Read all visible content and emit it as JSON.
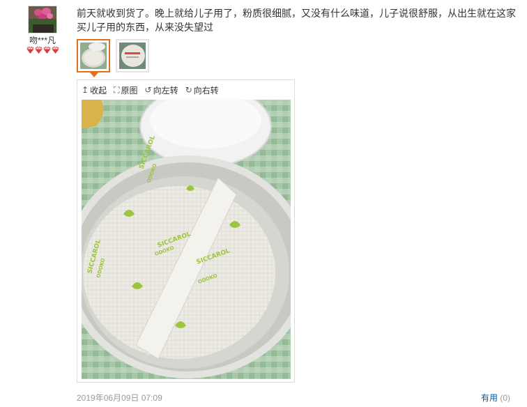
{
  "user": {
    "name": "吻***凡",
    "level_icon": "diamond-icon",
    "level_count": 4,
    "level_color": "#e4393c"
  },
  "review": {
    "text": "前天就收到货了。晚上就给儿子用了，粉质很细腻，又没有什么味道，儿子说很舒服，从出生就在这家买儿子用的东西，从来没失望过",
    "date": "2019年06月09日 07:09"
  },
  "viewer": {
    "collapse": "收起",
    "original": "原图",
    "rotate_left": "向左转",
    "rotate_right": "向右转"
  },
  "puff": {
    "brand": "SICCAROL",
    "sub": "ODOKO"
  },
  "actions": {
    "useful_label": "有用",
    "useful_count": "(0)"
  },
  "colors": {
    "accent_orange": "#e4701e",
    "link_blue": "#005aa0"
  }
}
